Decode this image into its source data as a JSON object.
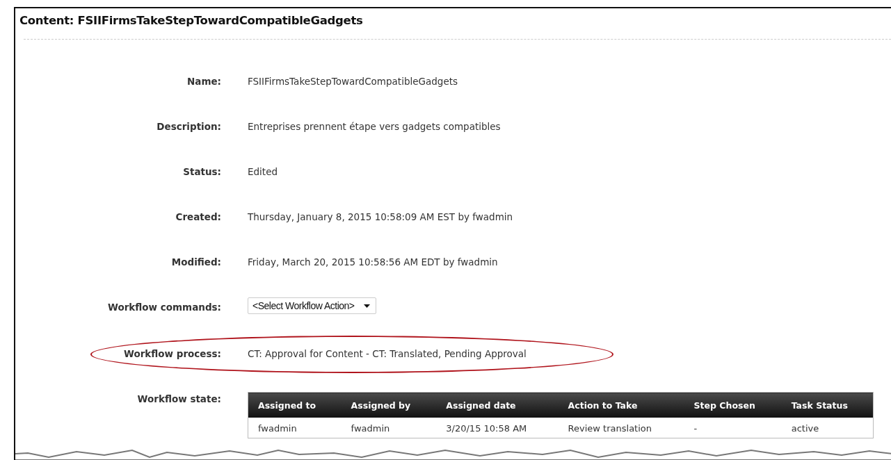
{
  "title": "Content: FSIIFirmsTakeStepTowardCompatibleGadgets",
  "fields": [
    {
      "label": "Name:",
      "kind": "text",
      "value": "FSIIFirmsTakeStepTowardCompatibleGadgets",
      "highlighted": false
    },
    {
      "label": "Description:",
      "kind": "text",
      "value": "Entreprises prennent étape vers gadgets compatibles",
      "highlighted": false
    },
    {
      "label": "Status:",
      "kind": "text",
      "value": "Edited",
      "highlighted": false
    },
    {
      "label": "Created:",
      "kind": "text",
      "value": "Thursday, January 8, 2015 10:58:09 AM EST by fwadmin",
      "highlighted": false
    },
    {
      "label": "Modified:",
      "kind": "text",
      "value": "Friday, March 20, 2015 10:58:56 AM EDT by fwadmin",
      "highlighted": false
    },
    {
      "label": "Workflow commands:",
      "kind": "select",
      "value": "<Select Workflow Action>",
      "highlighted": false
    },
    {
      "label": "Workflow process:",
      "kind": "text",
      "value": "CT: Approval for Content - CT: Translated, Pending Approval",
      "highlighted": true
    },
    {
      "label": "Workflow state:",
      "kind": "table",
      "highlighted": false,
      "table": {
        "columns": [
          "Assigned to",
          "Assigned by",
          "Assigned date",
          "Action to Take",
          "Step Chosen",
          "Task Status"
        ],
        "rows": [
          [
            "fwadmin",
            "fwadmin",
            "3/20/15 10:58 AM",
            "Review translation",
            "-",
            "active"
          ]
        ]
      }
    }
  ]
}
